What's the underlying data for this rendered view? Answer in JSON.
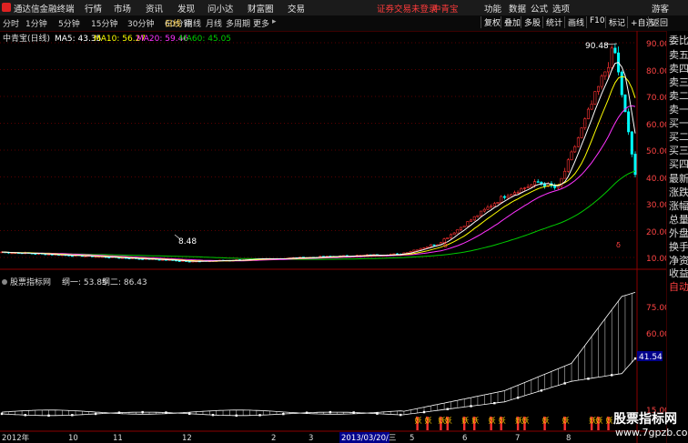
{
  "titlebar": {
    "app_name": "通达信金融终端",
    "menu": [
      "行情",
      "市场",
      "资讯",
      "发现",
      "问小达",
      "财富圈",
      "交易"
    ],
    "notice": "证券交易未登录",
    "stock": "中青宝",
    "right_menu": [
      "功能",
      "数据",
      "公式",
      "选项"
    ],
    "guest": "游客"
  },
  "toolbar": {
    "periods": [
      "分时",
      "1分钟",
      "5分钟",
      "15分钟",
      "30分钟",
      "60分钟",
      "日线",
      "周线",
      "月线",
      "多周期",
      "更多"
    ],
    "active_period": "日线",
    "right_buttons": [
      "复权",
      "叠加",
      "多股",
      "统计",
      "画线",
      "F10",
      "标记",
      "+自选",
      "返回"
    ]
  },
  "main_panel": {
    "title": "中青宝(日线)",
    "ma5_label": "MA5: 43.35",
    "ma10_label": "MA10: 56.27",
    "ma20_label": "MA20: 59.46",
    "ma60_label": "MA60: 45.05",
    "price_axis": [
      "90.00",
      "80.00",
      "70.00",
      "60.00",
      "50.00",
      "40.00",
      "30.00",
      "20.00",
      "10.00"
    ],
    "high_label": "90.48",
    "low_label": "8.48",
    "colors": {
      "ma5": "#ffffff",
      "ma10": "#ffff00",
      "ma20": "#ff33ff",
      "ma60": "#00cc00",
      "up": "#ff3232",
      "down": "#00ffff"
    }
  },
  "sub_panel": {
    "indicator_name": "股票指标网",
    "line1_label": "纲一: 53.85",
    "line2_label": "纲二: 86.43",
    "axis": [
      "75.00",
      "60.00",
      "15.00"
    ],
    "current_value": "41.54",
    "signal_text": "妖"
  },
  "date_axis": {
    "labels": [
      "2012年",
      "10",
      "11",
      "12",
      "2",
      "3",
      "5",
      "6",
      "7",
      "8"
    ],
    "cursor_date": "2013/03/20/三"
  },
  "side_panel": {
    "items": [
      "委比",
      "卖五",
      "卖四",
      "卖三",
      "卖二",
      "卖一",
      "买一",
      "买二",
      "买三",
      "买四",
      "最新",
      "涨跌",
      "涨幅",
      "总量",
      "外盘",
      "换手",
      "净资",
      "收益"
    ],
    "tab": "自动"
  },
  "watermark": {
    "title": "股票指标网",
    "url": "www.7gpzb.com"
  }
}
